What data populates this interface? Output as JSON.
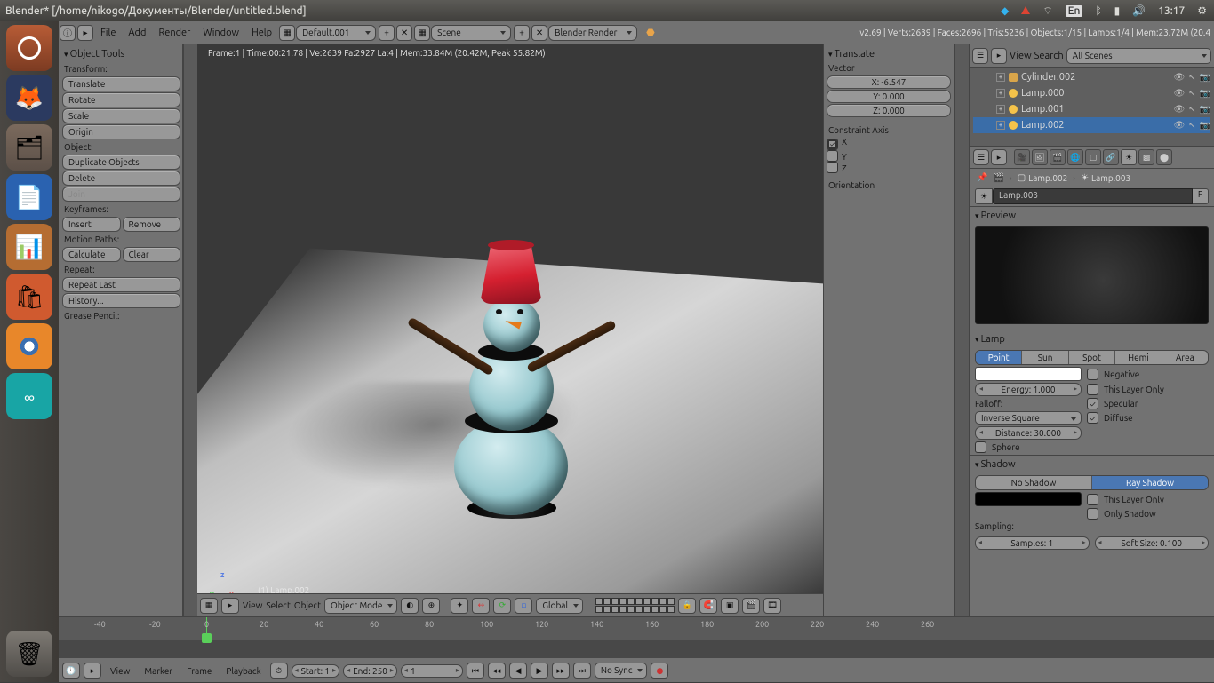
{
  "ubuntu": {
    "title": "Blender* [/home/nikogo/Документы/Blender/untitled.blend]",
    "lang": "En",
    "time": "13:17"
  },
  "info": {
    "menus": {
      "file": "File",
      "add": "Add",
      "render": "Render",
      "window": "Window",
      "help": "Help"
    },
    "layout": "Default.001",
    "scene": "Scene",
    "engine": "Blender Render",
    "stats": "v2.69 | Verts:2639 | Faces:2696 | Tris:5236 | Objects:1/15 | Lamps:1/4 | Mem:23.72M (20.4"
  },
  "toolshelf": {
    "hd": "Object Tools",
    "transform_lbl": "Transform:",
    "translate": "Translate",
    "rotate": "Rotate",
    "scale": "Scale",
    "origin": "Origin",
    "object_lbl": "Object:",
    "duplicate": "Duplicate Objects",
    "delete": "Delete",
    "join": "Join",
    "keyframes_lbl": "Keyframes:",
    "insert": "Insert",
    "remove": "Remove",
    "motion_lbl": "Motion Paths:",
    "calculate": "Calculate",
    "clear": "Clear",
    "repeat_lbl": "Repeat:",
    "repeat_last": "Repeat Last",
    "history": "History...",
    "gp_lbl": "Grease Pencil:"
  },
  "viewport": {
    "stats": "Frame:1 | Time:00:21.78 | Ve:2639 Fa:2927 La:4 | Mem:33.84M (20.42M, Peak 55.82M)",
    "obj_name": "(1) Lamp.002",
    "header": {
      "view": "View",
      "select": "Select",
      "object": "Object",
      "mode": "Object Mode",
      "orient": "Global"
    }
  },
  "operator": {
    "hd": "Translate",
    "vector_lbl": "Vector",
    "x": "X: -6.547",
    "y": "Y: 0.000",
    "z": "Z: 0.000",
    "constraint_lbl": "Constraint Axis",
    "cx": "X",
    "cy": "Y",
    "cz": "Z",
    "orient_lbl": "Orientation"
  },
  "outliner": {
    "view": "View",
    "search": "Search",
    "scope": "All Scenes",
    "rows": [
      {
        "name": "Cylinder.002",
        "type": "cyl"
      },
      {
        "name": "Lamp.000",
        "type": "lamp"
      },
      {
        "name": "Lamp.001",
        "type": "lamp"
      },
      {
        "name": "Lamp.002",
        "type": "lamp",
        "sel": true
      }
    ]
  },
  "props": {
    "crumb1": "Lamp.002",
    "crumb2": "Lamp.003",
    "name": "Lamp.003",
    "f": "F",
    "preview_hd": "Preview",
    "lamp_hd": "Lamp",
    "types": {
      "point": "Point",
      "sun": "Sun",
      "spot": "Spot",
      "hemi": "Hemi",
      "area": "Area"
    },
    "energy": "Energy: 1.000",
    "negative": "Negative",
    "layer_only": "This Layer Only",
    "specular": "Specular",
    "diffuse": "Diffuse",
    "falloff_lbl": "Falloff:",
    "falloff": "Inverse Square",
    "distance": "Distance: 30.000",
    "sphere": "Sphere",
    "shadow_hd": "Shadow",
    "noshadow": "No Shadow",
    "rayshadow": "Ray Shadow",
    "only_shadow": "Only Shadow",
    "sampling_lbl": "Sampling:",
    "samples": "Samples: 1",
    "softsize": "Soft Size: 0.100"
  },
  "timeline": {
    "ticks": [
      "-40",
      "-20",
      "0",
      "20",
      "40",
      "60",
      "80",
      "100",
      "120",
      "140",
      "160",
      "180",
      "200",
      "220",
      "240",
      "260"
    ],
    "menus": {
      "view": "View",
      "marker": "Marker",
      "frame": "Frame",
      "playback": "Playback"
    },
    "start": "Start: 1",
    "end": "End: 250",
    "current": "1",
    "sync": "No Sync"
  }
}
